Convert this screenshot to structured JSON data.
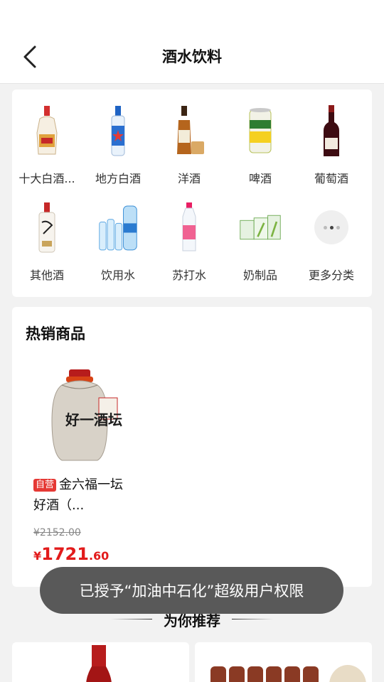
{
  "header": {
    "title": "酒水饮料"
  },
  "categories": [
    {
      "label": "十大白酒...",
      "icon": "baijiu-bottle-icon"
    },
    {
      "label": "地方白酒",
      "icon": "erguotou-bottle-icon"
    },
    {
      "label": "洋酒",
      "icon": "whisky-bottle-icon"
    },
    {
      "label": "啤酒",
      "icon": "beer-can-icon"
    },
    {
      "label": "葡萄酒",
      "icon": "wine-bottle-icon"
    },
    {
      "label": "其他酒",
      "icon": "liquor-bottle-icon"
    },
    {
      "label": "饮用水",
      "icon": "water-bottles-icon"
    },
    {
      "label": "苏打水",
      "icon": "soda-bottle-icon"
    },
    {
      "label": "奶制品",
      "icon": "milk-cartons-icon"
    },
    {
      "label": "更多分类",
      "icon": "more-dots-icon"
    }
  ],
  "hot": {
    "title": "热销商品",
    "product": {
      "tag": "自营",
      "name": "金六福一坛好酒（...",
      "original_price": "¥2152.00",
      "price_currency": "¥",
      "price_int": "1721",
      "price_dec": ".60",
      "jar_label": "好一酒坛"
    }
  },
  "recommend": {
    "title": "为你推荐"
  },
  "toast": {
    "text": "已授予“加油中石化”超级用户权限"
  }
}
